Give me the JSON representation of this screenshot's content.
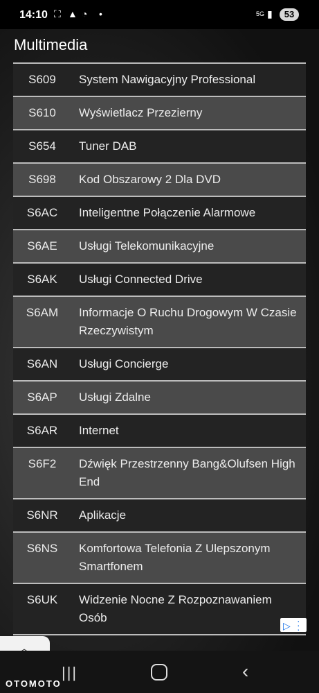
{
  "status": {
    "time": "14:10",
    "network": "5G",
    "battery": "53"
  },
  "section_title": "Multimedia",
  "rows": [
    {
      "code": "S609",
      "desc": "System Nawigacyjny Professional"
    },
    {
      "code": "S610",
      "desc": "Wyświetlacz Przezierny"
    },
    {
      "code": "S654",
      "desc": "Tuner DAB"
    },
    {
      "code": "S698",
      "desc": "Kod Obszarowy 2 Dla DVD"
    },
    {
      "code": "S6AC",
      "desc": "Inteligentne Połączenie Alarmowe"
    },
    {
      "code": "S6AE",
      "desc": "Usługi Telekomunikacyjne"
    },
    {
      "code": "S6AK",
      "desc": "Usługi Connected Drive"
    },
    {
      "code": "S6AM",
      "desc": "Informacje O Ruchu Drogowym W Czasie Rzeczywistym"
    },
    {
      "code": "S6AN",
      "desc": "Usługi Concierge"
    },
    {
      "code": "S6AP",
      "desc": "Usługi Zdalne"
    },
    {
      "code": "S6AR",
      "desc": "Internet"
    },
    {
      "code": "S6F2",
      "desc": "Dźwięk Przestrzenny Bang&Olufsen High End"
    },
    {
      "code": "S6NR",
      "desc": "Aplikacje"
    },
    {
      "code": "S6NS",
      "desc": "Komfortowa Telefonia Z Ulepszonym Smartfonem"
    },
    {
      "code": "S6UK",
      "desc": "Widzenie Nocne Z Rozpoznawaniem Osób"
    }
  ],
  "watermark": "OTOMOTO",
  "icons": {
    "back": "back-icon",
    "home": "home-icon",
    "recent": "recent-apps-icon",
    "ad": "adchoices-icon",
    "scroll_up": "chevron-up-icon"
  }
}
